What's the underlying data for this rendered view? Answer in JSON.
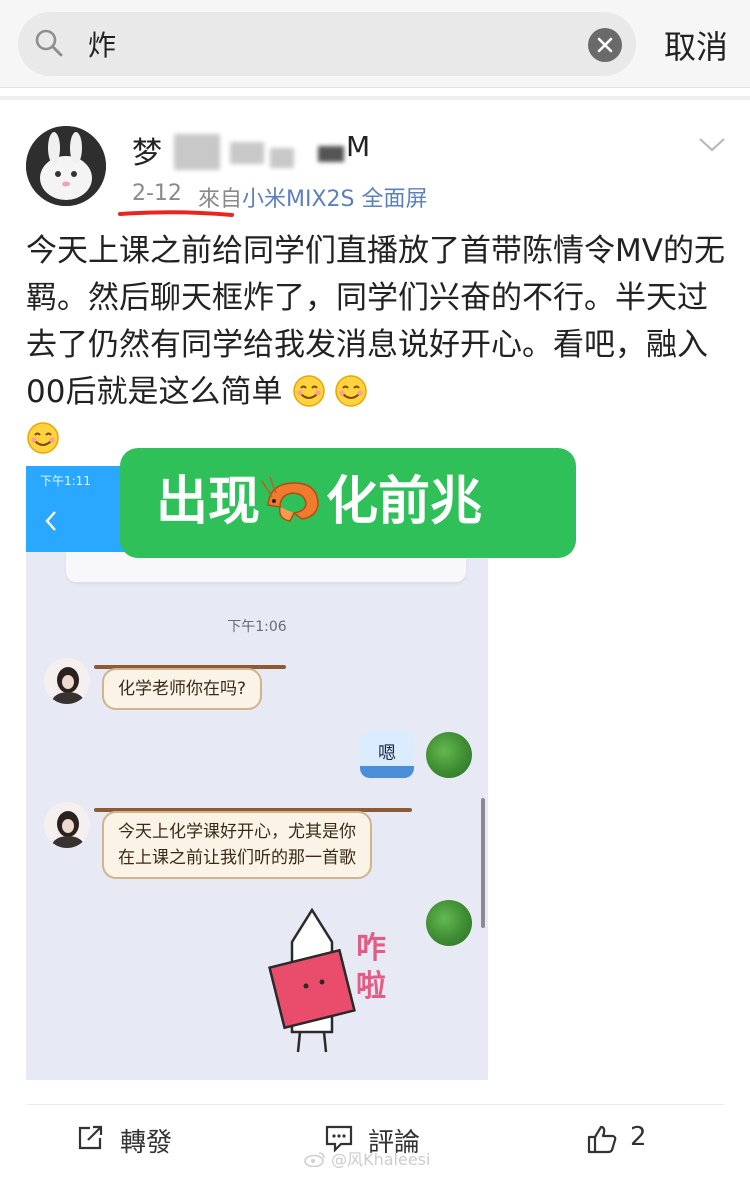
{
  "search": {
    "query": "炸",
    "cancel_label": "取消"
  },
  "post": {
    "username_first": "梦",
    "username_tail": "M",
    "date": "2-12",
    "source_prefix": "來自",
    "source": "小米MIX2S 全面屏",
    "text": "今天上课之前给同学们直播放了首带陈情令MV的无羁。然后聊天框炸了，同学们兴奋的不行。半天过去了仍然有同学给我发消息说好开心。看吧，融入00后就是这么简单 ",
    "emoji": [
      "smiley-icon",
      "smiley-icon",
      "smiley-icon"
    ]
  },
  "screenshot": {
    "status_time": "下午1:11",
    "chat_time": "下午1:06",
    "messages": [
      {
        "side": "left",
        "text": "化学老师你在吗?"
      },
      {
        "side": "right",
        "text": "嗯"
      },
      {
        "side": "left",
        "lines": [
          "今天上化学课好开心，尤其是你",
          "在上课之前让我们听的那一首歌"
        ]
      }
    ],
    "sticker_text": [
      "咋",
      "啦"
    ]
  },
  "overlay": {
    "text_before": "出现",
    "icon": "shrimp-icon",
    "text_after": "化前兆",
    "color": "#2fc05a"
  },
  "actions": {
    "repost": "轉發",
    "comment": "評論",
    "like_count": "2"
  },
  "watermark": "@风Khaleesi",
  "colors": {
    "link": "#5b7fbf",
    "underline": "#e8261e",
    "chat_topbar": "#2aa7ff"
  }
}
